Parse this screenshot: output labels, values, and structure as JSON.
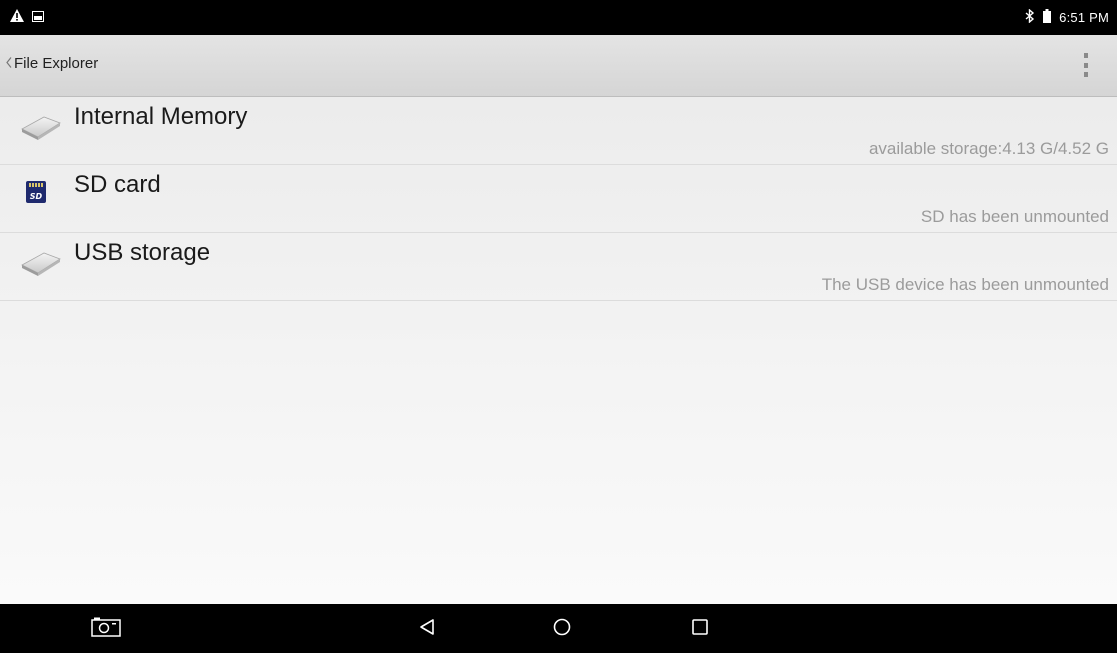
{
  "status_bar": {
    "left_icons": [
      "warning-icon",
      "image-notification-icon"
    ],
    "right_icons": [
      "bluetooth-icon",
      "battery-icon"
    ],
    "time": "6:51 PM"
  },
  "action_bar": {
    "back_icon": "chevron-left-icon",
    "title": "File Explorer",
    "overflow_icon": "more-vertical-icon"
  },
  "storage_list": [
    {
      "label": "Internal Memory",
      "status": "available storage:4.13 G/4.52 G",
      "icon": "drive-icon"
    },
    {
      "label": "SD card",
      "status": "SD has been unmounted",
      "icon": "sd-card-icon",
      "icon_text": "SD"
    },
    {
      "label": "USB storage",
      "status": "The USB device has been unmounted",
      "icon": "drive-icon"
    }
  ],
  "nav_bar": {
    "buttons": [
      "screenshot-icon",
      "back-triangle-icon",
      "home-circle-icon",
      "recents-square-icon"
    ]
  },
  "colors": {
    "status_bar_bg": "#000000",
    "action_bar_bg": "#dcdcdc",
    "content_bg": "#f2f2f2",
    "label_text": "#1a1a1a",
    "status_text": "#9b9b9b",
    "sd_icon_bg": "#1f2a6e"
  }
}
